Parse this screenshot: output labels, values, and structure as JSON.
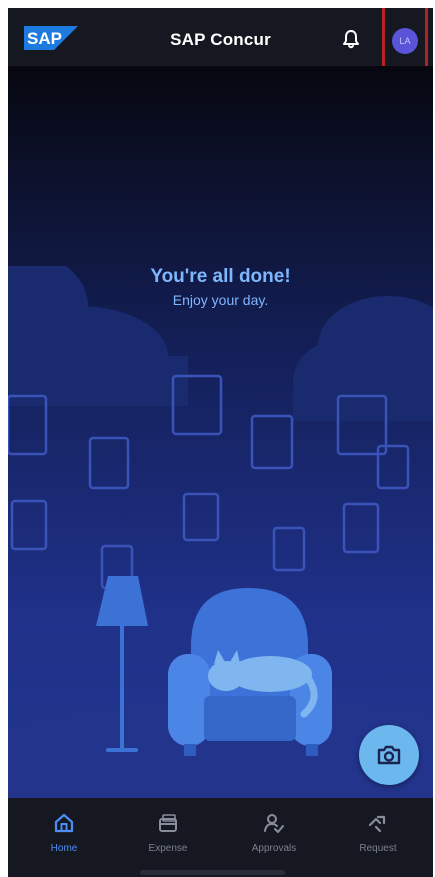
{
  "header": {
    "logo_text": "SAP",
    "title": "SAP Concur",
    "notification_icon": "bell-icon",
    "avatar_initials": "LA",
    "avatar_color": "#5a54d8"
  },
  "empty_state": {
    "title": "You're all done!",
    "subtitle": "Enjoy your day."
  },
  "fab": {
    "icon": "camera-icon",
    "color": "#6bb7ee"
  },
  "bottom_nav": {
    "items": [
      {
        "label": "Home",
        "icon": "home-icon",
        "active": true
      },
      {
        "label": "Expense",
        "icon": "expense-icon",
        "active": false
      },
      {
        "label": "Approvals",
        "icon": "approvals-icon",
        "active": false
      },
      {
        "label": "Request",
        "icon": "request-icon",
        "active": false
      }
    ]
  },
  "colors": {
    "accent": "#4c8df6",
    "bar_background": "#151821",
    "highlight": "#b52424"
  }
}
